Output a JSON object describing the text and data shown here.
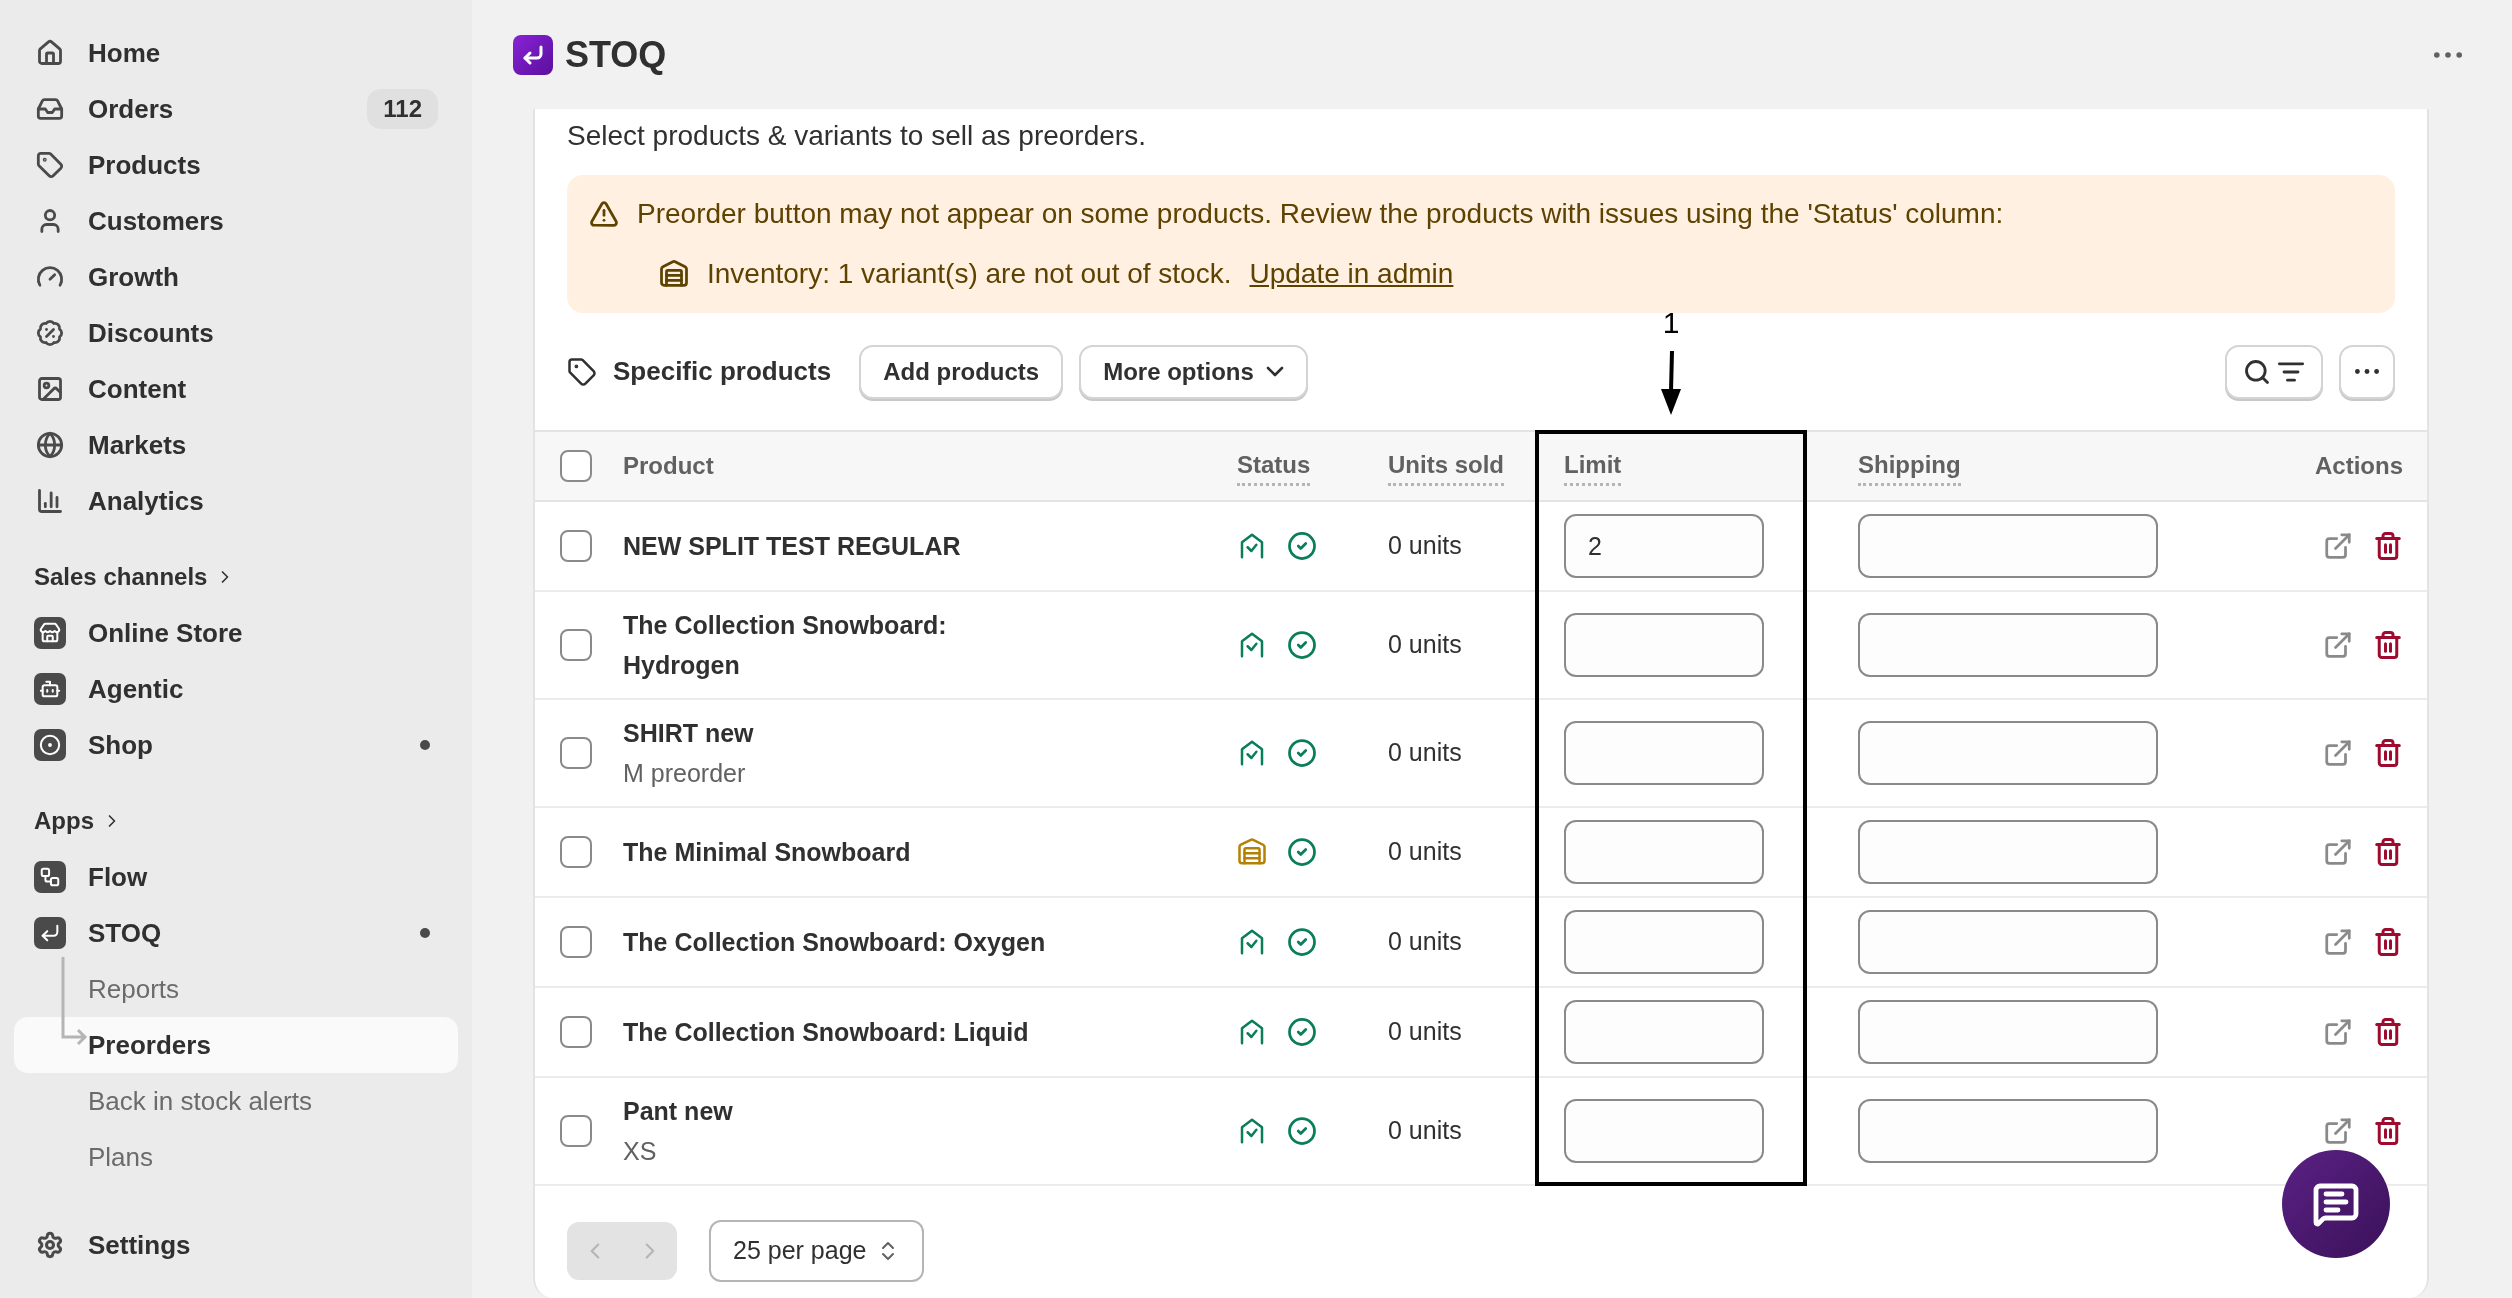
{
  "sidebar": {
    "sections": [
      {
        "items": [
          {
            "label": "Home",
            "selected": false,
            "has_dot": false
          },
          {
            "label": "Orders",
            "badge": "112",
            "selected": false,
            "has_dot": false
          },
          {
            "label": "Products",
            "selected": false,
            "has_dot": false
          },
          {
            "label": "Customers",
            "selected": false,
            "has_dot": false
          },
          {
            "label": "Growth",
            "selected": false,
            "has_dot": false
          },
          {
            "label": "Discounts",
            "selected": false,
            "has_dot": false
          },
          {
            "label": "Content",
            "selected": false,
            "has_dot": false
          },
          {
            "label": "Markets",
            "selected": false,
            "has_dot": false
          },
          {
            "label": "Analytics",
            "selected": false,
            "has_dot": false
          }
        ]
      },
      {
        "title": "Sales channels",
        "items": [
          {
            "label": "Online Store",
            "selected": false,
            "has_dot": false
          },
          {
            "label": "Agentic",
            "selected": false,
            "has_dot": false
          },
          {
            "label": "Shop",
            "selected": false,
            "has_dot": true
          }
        ]
      },
      {
        "title": "Apps",
        "items": [
          {
            "label": "Flow",
            "selected": false,
            "has_dot": false
          },
          {
            "label": "STOQ",
            "selected": false,
            "has_dot": true,
            "children": [
              {
                "label": "Reports",
                "selected": false
              },
              {
                "label": "Preorders",
                "selected": true
              },
              {
                "label": "Back in stock alerts",
                "selected": false
              },
              {
                "label": "Plans",
                "selected": false
              }
            ]
          }
        ]
      }
    ],
    "settings": {
      "label": "Settings",
      "selected": false
    }
  },
  "header": {
    "title": "STOQ"
  },
  "card": {
    "description": "Select products & variants to sell as preorders.",
    "alert": {
      "message": "Preorder button may not appear on some products. Review the products with issues using the 'Status' column:",
      "detail": "Inventory: 1 variant(s) are not out of stock.",
      "link": "Update in admin"
    },
    "toolbar": {
      "label": "Specific products",
      "buttons": [
        {
          "label": "Add products",
          "has_menu": false
        },
        {
          "label": "More options",
          "has_menu": true
        }
      ]
    },
    "annotation": {
      "label": "1"
    },
    "table": {
      "header_checked": false,
      "columns": [
        {
          "label": "Product",
          "has_tooltip": false,
          "highlighted": false
        },
        {
          "label": "Status",
          "has_tooltip": true,
          "highlighted": false
        },
        {
          "label": "Units sold",
          "has_tooltip": true,
          "highlighted": false
        },
        {
          "label": "Limit",
          "has_tooltip": true,
          "highlighted": true
        },
        {
          "label": "Shipping",
          "has_tooltip": true,
          "highlighted": false
        },
        {
          "label": "Actions",
          "has_tooltip": false,
          "highlighted": false
        }
      ],
      "rows": [
        {
          "name": "NEW SPLIT TEST REGULAR",
          "checked": false,
          "inventory_issue": false,
          "units": "0 units",
          "limit": "2"
        },
        {
          "name": "The Collection Snowboard: Hydrogen",
          "checked": false,
          "inventory_issue": false,
          "units": "0 units"
        },
        {
          "name": "SHIRT new",
          "variant": "M preorder",
          "checked": false,
          "inventory_issue": false,
          "units": "0 units"
        },
        {
          "name": "The Minimal Snowboard",
          "checked": false,
          "inventory_issue": true,
          "units": "0 units"
        },
        {
          "name": "The Collection Snowboard: Oxygen",
          "checked": false,
          "inventory_issue": false,
          "units": "0 units"
        },
        {
          "name": "The Collection Snowboard: Liquid",
          "checked": false,
          "inventory_issue": false,
          "units": "0 units"
        },
        {
          "name": "Pant new",
          "variant": "XS",
          "checked": false,
          "inventory_issue": false,
          "units": "0 units"
        }
      ]
    },
    "pagination": {
      "previous_disabled": true,
      "next_disabled": true,
      "per_page": "25 per page"
    }
  }
}
